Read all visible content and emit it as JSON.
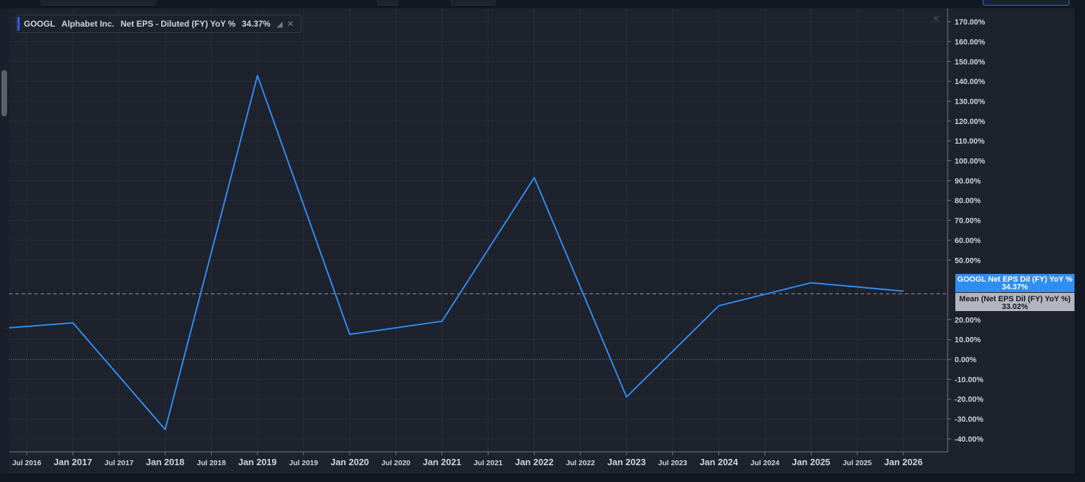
{
  "legend": {
    "symbol": "GOOGL",
    "company": "Alphabet Inc.",
    "metric": "Net EPS - Diluted (FY) YoY %",
    "value": "34.37%",
    "icons": [
      "chart-settings-icon",
      "close-icon"
    ]
  },
  "chart_data": {
    "type": "line",
    "x": [
      "Jul 2016",
      "Jan 2017",
      "Jan 2018",
      "Jan 2019",
      "Jan 2020",
      "Jan 2021",
      "Jan 2022",
      "Jan 2023",
      "Jan 2024",
      "Jan 2025",
      "Jan 2026"
    ],
    "series": [
      {
        "name": "GOOGL Net EPS Dil (FY) YoY %",
        "color": "#2f8ef4",
        "values": [
          15.8,
          18.4,
          -35.3,
          142.9,
          12.6,
          19.2,
          91.5,
          -18.9,
          27.0,
          38.6,
          34.37
        ]
      }
    ],
    "mean": {
      "name": "Mean (Net EPS Dil (FY) YoY %)",
      "value": 33.02,
      "label": "33.02%"
    },
    "last_value_label": {
      "name": "GOOGL Net EPS Dil (FY) YoY %",
      "label": "34.37%"
    },
    "zero_line": true,
    "y_ticks": [
      "170.00%",
      "160.00%",
      "150.00%",
      "140.00%",
      "130.00%",
      "120.00%",
      "110.00%",
      "100.00%",
      "90.00%",
      "80.00%",
      "70.00%",
      "60.00%",
      "50.00%",
      "20.00%",
      "10.00%",
      "0.00%",
      "-10.00%",
      "-20.00%",
      "-30.00%",
      "-40.00%"
    ],
    "ylim": [
      -45,
      176
    ],
    "x_ticks": [
      {
        "label": "Jul 2016",
        "major": false
      },
      {
        "label": "Jan 2017",
        "major": true
      },
      {
        "label": "Jul 2017",
        "major": false
      },
      {
        "label": "Jan 2018",
        "major": true
      },
      {
        "label": "Jul 2018",
        "major": false
      },
      {
        "label": "Jan 2019",
        "major": true
      },
      {
        "label": "Jul 2019",
        "major": false
      },
      {
        "label": "Jan 2020",
        "major": true
      },
      {
        "label": "Jul 2020",
        "major": false
      },
      {
        "label": "Jan 2021",
        "major": true
      },
      {
        "label": "Jul 2021",
        "major": false
      },
      {
        "label": "Jan 2022",
        "major": true
      },
      {
        "label": "Jul 2022",
        "major": false
      },
      {
        "label": "Jan 2023",
        "major": true
      },
      {
        "label": "Jul 2023",
        "major": false
      },
      {
        "label": "Jan 2024",
        "major": true
      },
      {
        "label": "Jul 2024",
        "major": false
      },
      {
        "label": "Jan 2025",
        "major": true
      },
      {
        "label": "Jul 2025",
        "major": false
      },
      {
        "label": "Jan 2026",
        "major": true
      }
    ],
    "grid": true,
    "colors": {
      "background": "#1e222d",
      "grid": "#2a2e39",
      "axis_text": "#d1d4dc",
      "line": "#2f8ef4",
      "mean_label_bg": "#b2b5be"
    }
  }
}
